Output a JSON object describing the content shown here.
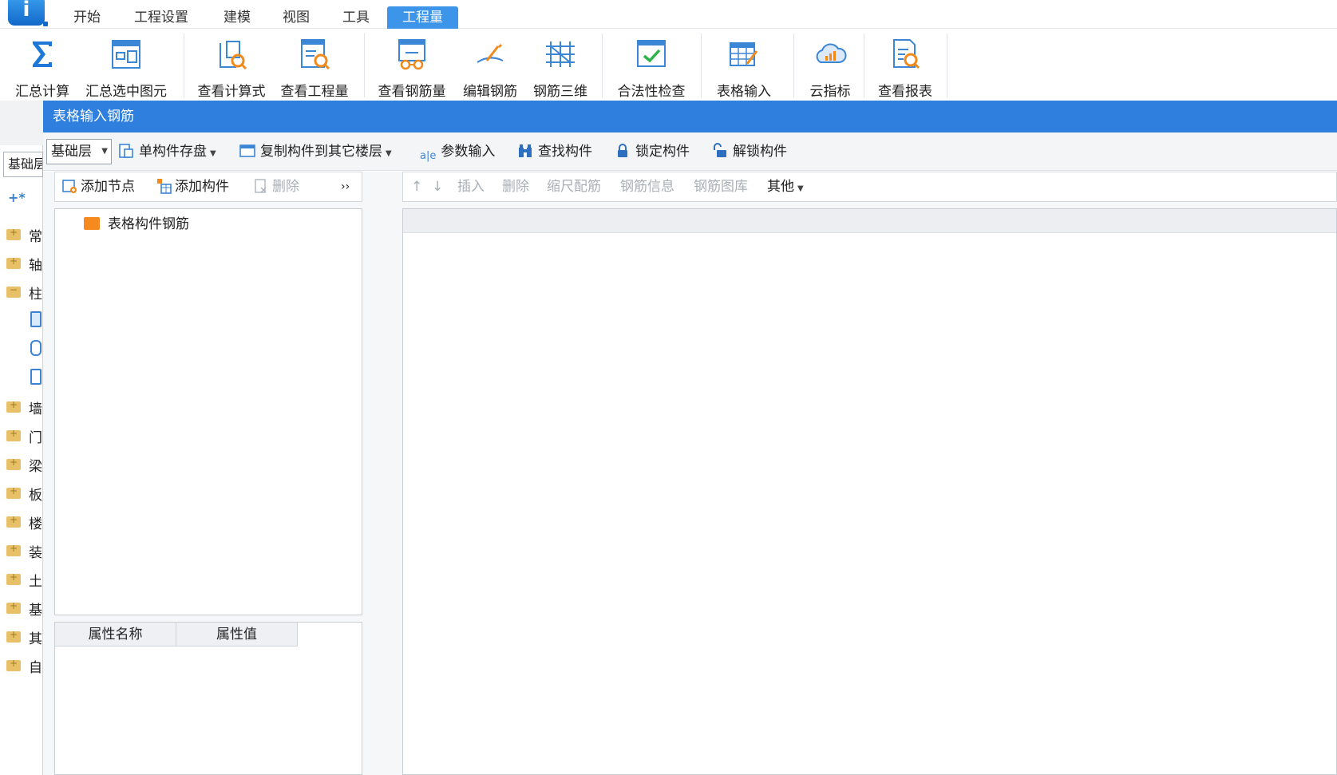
{
  "menu": {
    "tabs": [
      "开始",
      "工程设置",
      "建模",
      "视图",
      "工具",
      "工程量"
    ],
    "active_tab": "工程量"
  },
  "ribbon": {
    "buttons": [
      {
        "label": "汇总计算",
        "icon": "sigma-icon"
      },
      {
        "label": "汇总选中图元",
        "icon": "summary-selected-icon"
      },
      {
        "label": "查看计算式",
        "icon": "view-formula-icon"
      },
      {
        "label": "查看工程量",
        "icon": "view-quantity-icon"
      },
      {
        "label": "查看钢筋量",
        "icon": "view-rebar-icon"
      },
      {
        "label": "编辑钢筋",
        "icon": "edit-rebar-icon"
      },
      {
        "label": "钢筋三维",
        "icon": "rebar-3d-icon"
      },
      {
        "label": "合法性检查",
        "icon": "validity-check-icon"
      },
      {
        "label": "表格输入",
        "icon": "table-input-icon"
      },
      {
        "label": "云指标",
        "icon": "cloud-index-icon"
      },
      {
        "label": "查看报表",
        "icon": "view-report-icon"
      }
    ]
  },
  "left_panel": {
    "floor": "基础层",
    "tree": [
      {
        "label": "常",
        "open": false
      },
      {
        "label": "轴",
        "open": false
      },
      {
        "label": "柱",
        "open": true
      },
      {
        "label": "墙",
        "open": false
      },
      {
        "label": "门",
        "open": false
      },
      {
        "label": "梁",
        "open": false
      },
      {
        "label": "板",
        "open": false
      },
      {
        "label": "楼",
        "open": false
      },
      {
        "label": "装",
        "open": false
      },
      {
        "label": "土",
        "open": false
      },
      {
        "label": "基",
        "open": false
      },
      {
        "label": "其",
        "open": false
      },
      {
        "label": "自",
        "open": false
      }
    ]
  },
  "dialog": {
    "title": "表格输入钢筋",
    "toolbar": {
      "floor": "基础层",
      "save_single": "单构件存盘",
      "copy_to_floor": "复制构件到其它楼层",
      "param_input": "参数输入",
      "param_input_glyph": "a|e",
      "find": "查找构件",
      "lock": "锁定构件",
      "unlock": "解锁构件"
    },
    "tree_toolbar": {
      "add_node": "添加节点",
      "add_component": "添加构件",
      "delete": "删除",
      "more": "››"
    },
    "tree_root": "表格构件钢筋",
    "props": {
      "col_name": "属性名称",
      "col_value": "属性值"
    },
    "grid_toolbar": {
      "up": "↑",
      "down": "↓",
      "insert": "插入",
      "delete": "删除",
      "scale_rebar": "缩尺配筋",
      "rebar_info": "钢筋信息",
      "rebar_library": "钢筋图库",
      "other": "其他"
    }
  },
  "colors": {
    "accent": "#2f7fde",
    "active_tab": "#3c95e8",
    "folder": "#f58a1f"
  }
}
